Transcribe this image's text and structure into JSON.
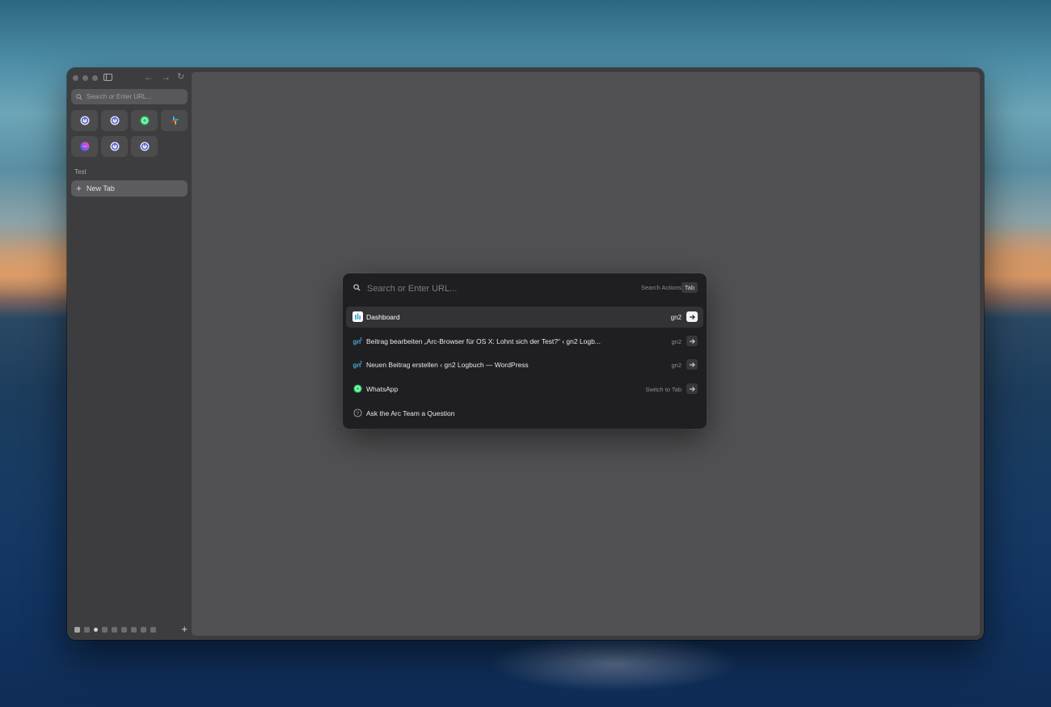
{
  "sidebar": {
    "search_placeholder": "Search or Enter URL...",
    "favorites": [
      {
        "name": "app-1",
        "icon": "power-icon",
        "color": "#6e7cf0"
      },
      {
        "name": "app-2",
        "icon": "power-icon",
        "color": "#6e7cf0"
      },
      {
        "name": "whatsapp",
        "icon": "whatsapp-icon",
        "color": "#25d366"
      },
      {
        "name": "slack",
        "icon": "slack-icon",
        "color": "#e01e5a"
      },
      {
        "name": "messenger",
        "icon": "messenger-icon",
        "color": "#e84a8c"
      },
      {
        "name": "app-6",
        "icon": "power-icon",
        "color": "#6e7cf0"
      },
      {
        "name": "app-7",
        "icon": "power-icon",
        "color": "#6e7cf0"
      }
    ],
    "space_label": "Test",
    "new_tab_label": "New Tab"
  },
  "palette": {
    "search_placeholder": "Search or Enter URL...",
    "search_actions_label": "Search Actions",
    "tab_key_label": "Tab",
    "results": [
      {
        "title": "Dashboard",
        "meta": "gn2",
        "icon": "dashboard-icon",
        "selected": true
      },
      {
        "title": "Beitrag bearbeiten „Arc-Browser für OS X: Lohnt sich der Test?“ ‹ gn2 Logb...",
        "meta": "gn2",
        "icon": "gn2-icon",
        "selected": false
      },
      {
        "title": "Neuen Beitrag erstellen ‹ gn2 Logbuch — WordPress",
        "meta": "gn2",
        "icon": "gn2-icon",
        "selected": false
      },
      {
        "title": "WhatsApp",
        "meta": "Switch to Tab",
        "icon": "whatsapp-icon",
        "selected": false
      },
      {
        "title": "Ask the Arc Team a Question",
        "meta": "",
        "icon": "question-icon",
        "selected": false
      }
    ]
  }
}
